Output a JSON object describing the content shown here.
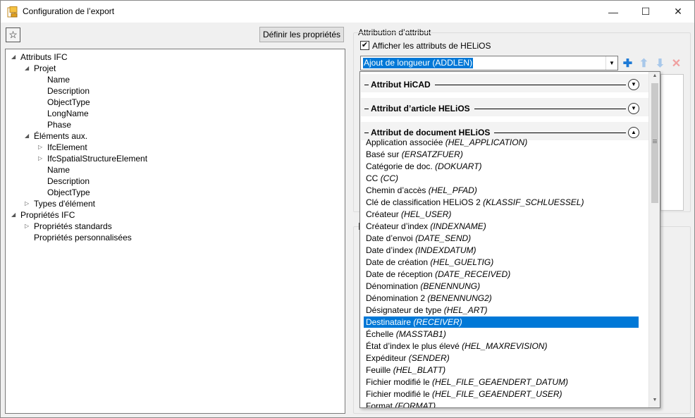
{
  "window": {
    "title": "Configuration de l’export",
    "minimize_glyph": "—",
    "maximize_glyph": "☐",
    "close_glyph": "✕"
  },
  "toolbar": {
    "star_glyph": "☆",
    "define_label": "Définir les propriétés"
  },
  "tree": [
    {
      "label": "Attributs IFC",
      "level": 0,
      "toggle": "expanded"
    },
    {
      "label": "Projet",
      "level": 1,
      "toggle": "expanded"
    },
    {
      "label": "Name",
      "level": 2,
      "toggle": "none"
    },
    {
      "label": "Description",
      "level": 2,
      "toggle": "none"
    },
    {
      "label": "ObjectType",
      "level": 2,
      "toggle": "none"
    },
    {
      "label": "LongName",
      "level": 2,
      "toggle": "none"
    },
    {
      "label": "Phase",
      "level": 2,
      "toggle": "none"
    },
    {
      "label": "Éléments aux.",
      "level": 1,
      "toggle": "expanded"
    },
    {
      "label": "IfcElement",
      "level": 2,
      "toggle": "collapsed"
    },
    {
      "label": "IfcSpatialStructureElement",
      "level": 2,
      "toggle": "collapsed"
    },
    {
      "label": "Name",
      "level": 2,
      "toggle": "none"
    },
    {
      "label": "Description",
      "level": 2,
      "toggle": "none"
    },
    {
      "label": "ObjectType",
      "level": 2,
      "toggle": "none"
    },
    {
      "label": "Types d'élément",
      "level": 1,
      "toggle": "collapsed"
    },
    {
      "label": "Propriétés IFC",
      "level": 0,
      "toggle": "expanded"
    },
    {
      "label": "Propriétés standards",
      "level": 1,
      "toggle": "collapsed"
    },
    {
      "label": "Propriétés personnalisées",
      "level": 1,
      "toggle": "none"
    }
  ],
  "attribution": {
    "group_label": "Attribution d’attribut",
    "show_helios_label": "Afficher les attributs de HELiOS",
    "show_helios_checked": true,
    "combo_value": "Ajout de longueur (ADDLEN)"
  },
  "dropdown": {
    "sections": [
      {
        "title": "Attribut HiCAD",
        "expanded": false
      },
      {
        "title": "Attribut d’article HELiOS",
        "expanded": false
      },
      {
        "title": "Attribut de document HELiOS",
        "expanded": true
      }
    ],
    "items": [
      {
        "name": "Application associée",
        "code": "(HEL_APPLICATION)",
        "selected": false
      },
      {
        "name": "Basé sur",
        "code": "(ERSATZFUER)",
        "selected": false
      },
      {
        "name": "Catégorie de doc.",
        "code": "(DOKUART)",
        "selected": false
      },
      {
        "name": "CC",
        "code": "(CC)",
        "selected": false
      },
      {
        "name": "Chemin d’accès",
        "code": "(HEL_PFAD)",
        "selected": false
      },
      {
        "name": "Clé de classification HELiOS 2",
        "code": "(KLASSIF_SCHLUESSEL)",
        "selected": false
      },
      {
        "name": "Créateur",
        "code": "(HEL_USER)",
        "selected": false
      },
      {
        "name": "Créateur d’index",
        "code": "(INDEXNAME)",
        "selected": false
      },
      {
        "name": "Date d’envoi",
        "code": "(DATE_SEND)",
        "selected": false
      },
      {
        "name": "Date d’index",
        "code": "(INDEXDATUM)",
        "selected": false
      },
      {
        "name": "Date de création",
        "code": "(HEL_GUELTIG)",
        "selected": false
      },
      {
        "name": "Date de réception",
        "code": "(DATE_RECEIVED)",
        "selected": false
      },
      {
        "name": "Dénomination",
        "code": "(BENENNUNG)",
        "selected": false
      },
      {
        "name": "Dénomination 2",
        "code": "(BENENNUNG2)",
        "selected": false
      },
      {
        "name": "Désignateur de type",
        "code": "(HEL_ART)",
        "selected": false
      },
      {
        "name": "Destinataire",
        "code": "(RECEIVER)",
        "selected": true
      },
      {
        "name": "Échelle",
        "code": "(MASSTAB1)",
        "selected": false
      },
      {
        "name": "État d’index le plus élevé",
        "code": "(HEL_MAXREVISION)",
        "selected": false
      },
      {
        "name": "Expéditeur",
        "code": "(SENDER)",
        "selected": false
      },
      {
        "name": "Feuille",
        "code": "(HEL_BLATT)",
        "selected": false
      },
      {
        "name": "Fichier modifié le",
        "code": "(HEL_FILE_GEAENDERT_DATUM)",
        "selected": false
      },
      {
        "name": "Fichier modifié le",
        "code": "(HEL_FILE_GEAENDERT_USER)",
        "selected": false
      },
      {
        "name": "Format",
        "code": "(FORMAT)",
        "selected": false
      }
    ]
  },
  "colors": {
    "selection": "#0078d7",
    "add_icon": "#1e7ad6",
    "disabled_arrow": "#a8c8ea",
    "disabled_delete": "#f0a0a0"
  }
}
